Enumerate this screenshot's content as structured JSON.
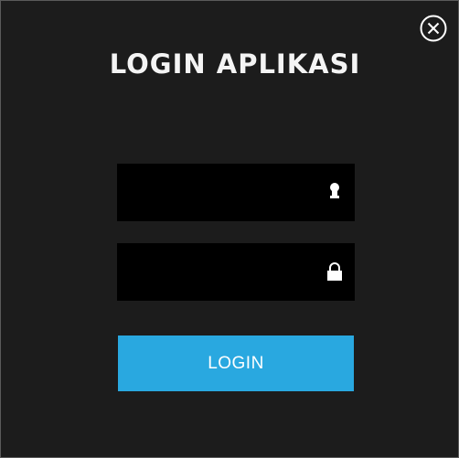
{
  "window": {
    "background": "#1c1c1c",
    "close_icon": "close-circle-icon"
  },
  "login": {
    "title": "LOGIN APLIKASI",
    "username": {
      "value": "",
      "placeholder": "",
      "icon": "user-icon"
    },
    "password": {
      "value": "",
      "placeholder": "",
      "icon": "lock-icon"
    },
    "button_label": "LOGIN",
    "accent_color": "#29a8e0"
  }
}
